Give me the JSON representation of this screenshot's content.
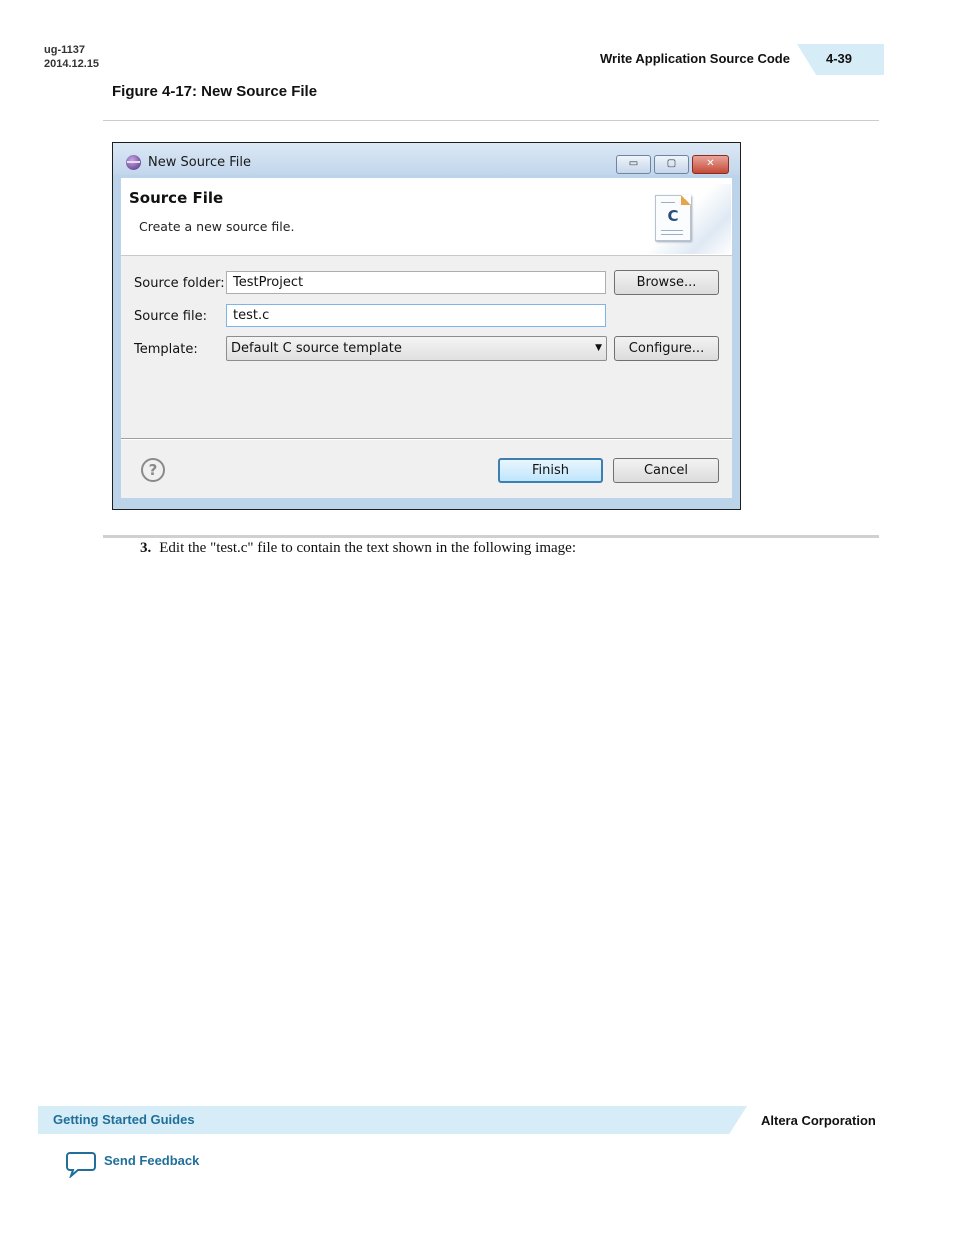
{
  "header": {
    "doc_id": "ug-1137",
    "doc_date": "2014.12.15",
    "section_title": "Write Application Source Code",
    "page_number": "4-39"
  },
  "figure": {
    "caption": "Figure 4-17: New Source File"
  },
  "dialog": {
    "title": "New Source File",
    "window_buttons": {
      "minimize": "▭",
      "maximize": "▢",
      "close": "✕"
    },
    "heading": "Source File",
    "description": "Create a new source file.",
    "banner_icon": "c-source-file-icon",
    "banner_icon_letter": "C",
    "source_folder": {
      "label": "Source folder:",
      "value": "TestProject"
    },
    "source_file": {
      "label": "Source file:",
      "value": "test.c"
    },
    "template": {
      "label": "Template:",
      "value": "Default C source template"
    },
    "browse_label": "Browse...",
    "configure_label": "Configure...",
    "help_glyph": "?",
    "finish_label": "Finish",
    "cancel_label": "Cancel"
  },
  "step": {
    "number": "3.",
    "text": "Edit the \"test.c\" file to contain the text shown in the following image:"
  },
  "footer": {
    "guide_title": "Getting Started Guides",
    "company": "Altera Corporation",
    "feedback_label": "Send Feedback",
    "feedback_icon": "speech-bubble-icon"
  },
  "colors": {
    "band": "#d6ecf6",
    "link": "#1f6f9a",
    "dialog_frame": "#bcd4ea"
  }
}
